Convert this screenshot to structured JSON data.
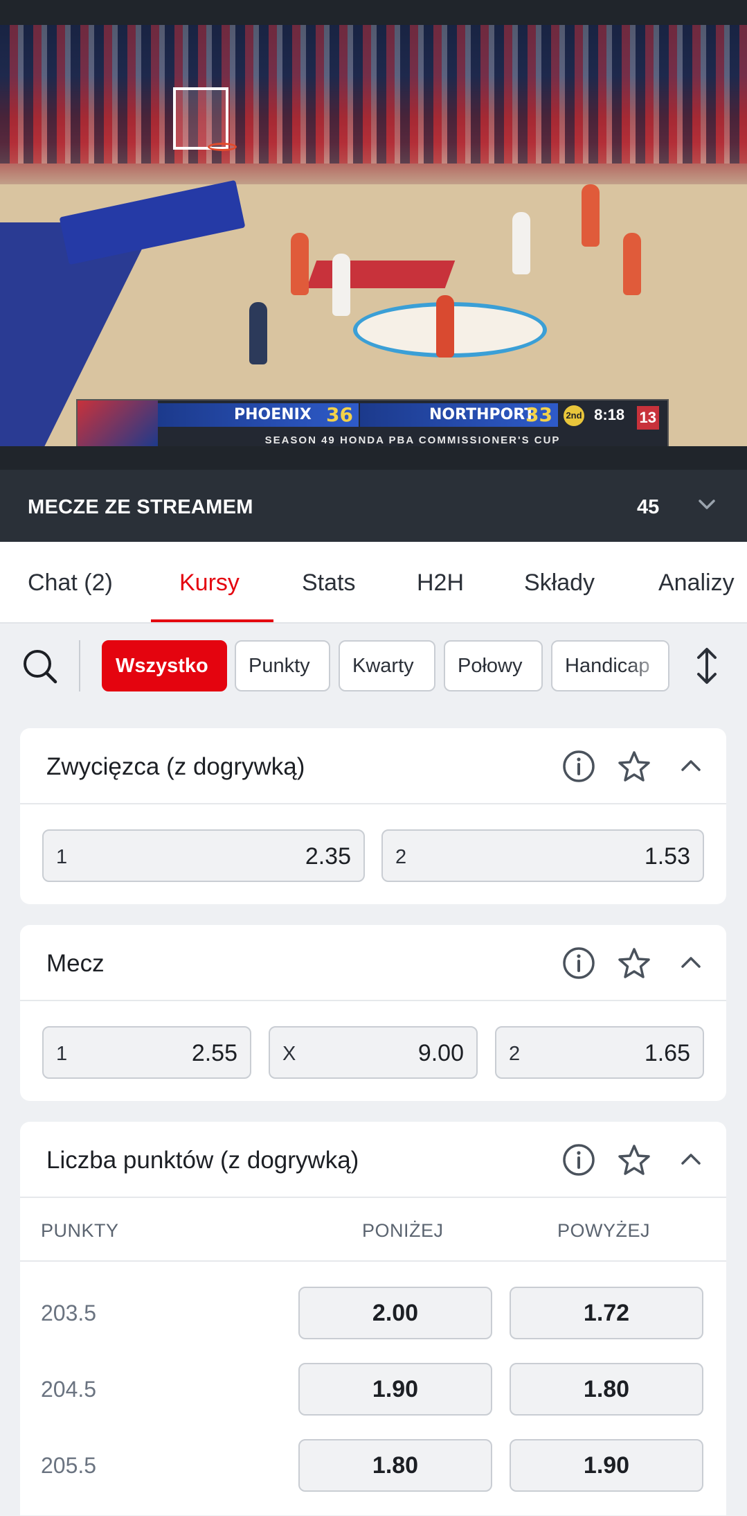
{
  "video": {
    "scoreboard": {
      "home_team": "PHOENIX",
      "home_score": "36",
      "away_team": "NORTHPORT",
      "away_score": "33",
      "period": "2nd",
      "clock": "8:18",
      "shot_clock": "13",
      "season": "SEASON 49 HONDA PBA COMMISSIONER'S CUP"
    }
  },
  "stream_bar": {
    "title": "MECZE ZE STREAMEM",
    "count": "45"
  },
  "tabs": [
    {
      "label": "Chat (2)"
    },
    {
      "label": "Kursy"
    },
    {
      "label": "Stats"
    },
    {
      "label": "H2H"
    },
    {
      "label": "Składy"
    },
    {
      "label": "Analizy"
    }
  ],
  "active_tab": "Kursy",
  "filters": [
    {
      "label": "Wszystko"
    },
    {
      "label": "Punkty"
    },
    {
      "label": "Kwarty"
    },
    {
      "label": "Połowy"
    },
    {
      "label": "Handicap"
    }
  ],
  "markets": {
    "winner": {
      "title": "Zwycięzca (z dogrywką)",
      "outcomes": [
        {
          "label": "1",
          "odds": "2.35"
        },
        {
          "label": "2",
          "odds": "1.53"
        }
      ]
    },
    "match": {
      "title": "Mecz",
      "outcomes": [
        {
          "label": "1",
          "odds": "2.55"
        },
        {
          "label": "X",
          "odds": "9.00"
        },
        {
          "label": "2",
          "odds": "1.65"
        }
      ]
    },
    "total": {
      "title": "Liczba punktów (z dogrywką)",
      "headers": {
        "line": "PUNKTY",
        "under": "PONIŻEJ",
        "over": "POWYŻEJ"
      },
      "rows": [
        {
          "line": "203.5",
          "under": "2.00",
          "over": "1.72"
        },
        {
          "line": "204.5",
          "under": "1.90",
          "over": "1.80"
        },
        {
          "line": "205.5",
          "under": "1.80",
          "over": "1.90"
        }
      ]
    }
  },
  "colors": {
    "accent": "#e4040f",
    "dark_bar": "#2a3038"
  }
}
